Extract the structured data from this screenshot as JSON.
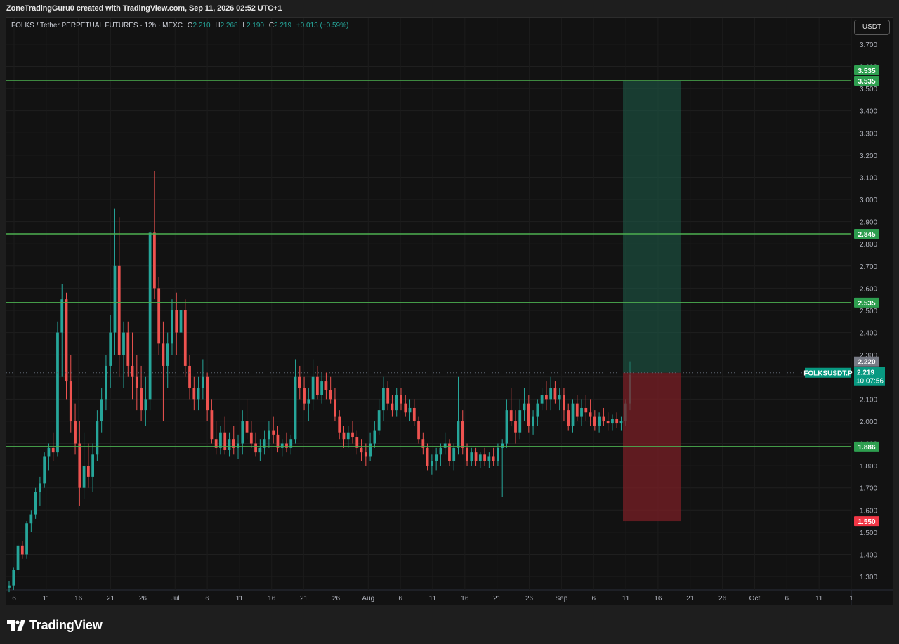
{
  "header": {
    "creator": "ZoneTradingGuru0 created with TradingView.com, Sep 11, 2026 02:52 UTC+1"
  },
  "legend": {
    "symbol": "FOLKS / Tether PERPETUAL FUTURES · 12h · MEXC",
    "o_label": "O",
    "o": "2.210",
    "h_label": "H",
    "h": "2.268",
    "l_label": "L",
    "l": "2.190",
    "c_label": "C",
    "c": "2.219",
    "change": "+0.013 (+0.59%)"
  },
  "currency_button": "USDT",
  "footer": {
    "brand": "TradingView"
  },
  "colors": {
    "up": "#26a69a",
    "down": "#ef5350",
    "level_line": "#4caf50",
    "target_zone": "#1e5f4b",
    "stop_zone": "#7a1f26",
    "price_tag": "#089981",
    "stop_tag": "#f23645",
    "background": "#121212"
  },
  "chart_data": {
    "type": "candlestick",
    "title": "FOLKS / Tether PERPETUAL FUTURES · 12h · MEXC",
    "timeframe": "12h",
    "y_range": [
      1.24,
      3.82
    ],
    "y_ticks": [
      "3.700",
      "3.600",
      "3.500",
      "3.400",
      "3.300",
      "3.200",
      "3.100",
      "3.000",
      "2.900",
      "2.800",
      "2.700",
      "2.600",
      "2.500",
      "2.400",
      "2.300",
      "2.200",
      "2.100",
      "2.000",
      "1.900",
      "1.800",
      "1.700",
      "1.600",
      "1.500",
      "1.400",
      "1.300"
    ],
    "x_ticks": [
      "6",
      "11",
      "16",
      "21",
      "26",
      "Jul",
      "6",
      "11",
      "16",
      "21",
      "26",
      "Aug",
      "6",
      "11",
      "16",
      "21",
      "26",
      "Sep",
      "6",
      "11",
      "16",
      "21",
      "26",
      "Oct",
      "6",
      "11",
      "1"
    ],
    "horizontal_levels": [
      {
        "price": 3.535,
        "label": "3.535"
      },
      {
        "price": 2.845,
        "label": "2.845"
      },
      {
        "price": 2.535,
        "label": "2.535"
      },
      {
        "price": 1.886,
        "label": "1.886"
      }
    ],
    "position": {
      "type": "long",
      "entry": 2.219,
      "target": 3.535,
      "stop": 1.55,
      "target_label": "3.535",
      "stop_label": "1.550"
    },
    "last_price": {
      "symbol": "FOLKSUSDT.P",
      "price": "2.219",
      "countdown": "10:07:56",
      "high_marker": "2.220"
    },
    "candles": [
      [
        1.25,
        1.28,
        1.23,
        1.26
      ],
      [
        1.26,
        1.34,
        1.24,
        1.33
      ],
      [
        1.33,
        1.45,
        1.31,
        1.44
      ],
      [
        1.44,
        1.46,
        1.38,
        1.4
      ],
      [
        1.4,
        1.55,
        1.38,
        1.54
      ],
      [
        1.54,
        1.6,
        1.5,
        1.58
      ],
      [
        1.58,
        1.7,
        1.56,
        1.68
      ],
      [
        1.68,
        1.75,
        1.62,
        1.72
      ],
      [
        1.72,
        1.86,
        1.7,
        1.84
      ],
      [
        1.84,
        1.9,
        1.78,
        1.88
      ],
      [
        1.88,
        1.95,
        1.82,
        1.86
      ],
      [
        1.86,
        2.45,
        1.84,
        2.4
      ],
      [
        2.4,
        2.62,
        2.2,
        2.55
      ],
      [
        2.55,
        2.58,
        2.1,
        2.18
      ],
      [
        2.18,
        2.3,
        1.95,
        2.0
      ],
      [
        2.0,
        2.08,
        1.85,
        1.9
      ],
      [
        1.9,
        2.0,
        1.62,
        1.7
      ],
      [
        1.7,
        1.95,
        1.65,
        1.8
      ],
      [
        1.8,
        1.9,
        1.7,
        1.75
      ],
      [
        1.75,
        1.9,
        1.68,
        1.85
      ],
      [
        1.85,
        2.05,
        1.82,
        2.0
      ],
      [
        2.0,
        2.15,
        1.95,
        2.1
      ],
      [
        2.1,
        2.3,
        2.05,
        2.25
      ],
      [
        2.25,
        2.48,
        2.15,
        2.4
      ],
      [
        2.4,
        2.96,
        2.3,
        2.7
      ],
      [
        2.7,
        2.92,
        2.2,
        2.3
      ],
      [
        2.3,
        2.45,
        2.15,
        2.4
      ],
      [
        2.4,
        2.45,
        2.2,
        2.25
      ],
      [
        2.25,
        2.4,
        2.1,
        2.2
      ],
      [
        2.2,
        2.3,
        2.05,
        2.15
      ],
      [
        2.15,
        2.25,
        2.0,
        2.05
      ],
      [
        2.05,
        2.2,
        1.98,
        2.1
      ],
      [
        2.1,
        2.86,
        2.05,
        2.85
      ],
      [
        2.85,
        3.13,
        2.55,
        2.6
      ],
      [
        2.6,
        2.65,
        2.3,
        2.35
      ],
      [
        2.35,
        2.45,
        2.0,
        2.25
      ],
      [
        2.25,
        2.4,
        2.15,
        2.35
      ],
      [
        2.35,
        2.55,
        2.3,
        2.5
      ],
      [
        2.5,
        2.58,
        2.3,
        2.4
      ],
      [
        2.4,
        2.6,
        2.35,
        2.5
      ],
      [
        2.5,
        2.55,
        2.2,
        2.25
      ],
      [
        2.25,
        2.3,
        2.1,
        2.15
      ],
      [
        2.15,
        2.2,
        2.05,
        2.1
      ],
      [
        2.1,
        2.2,
        2.05,
        2.15
      ],
      [
        2.15,
        2.28,
        2.1,
        2.2
      ],
      [
        2.2,
        2.22,
        2.0,
        2.05
      ],
      [
        2.05,
        2.1,
        1.9,
        1.92
      ],
      [
        1.92,
        2.0,
        1.85,
        1.88
      ],
      [
        1.88,
        1.98,
        1.85,
        1.95
      ],
      [
        1.95,
        2.02,
        1.85,
        1.87
      ],
      [
        1.87,
        1.95,
        1.84,
        1.92
      ],
      [
        1.92,
        1.98,
        1.85,
        1.88
      ],
      [
        1.88,
        1.94,
        1.83,
        1.9
      ],
      [
        1.9,
        2.05,
        1.85,
        2.0
      ],
      [
        2.0,
        2.1,
        1.92,
        1.95
      ],
      [
        1.95,
        2.0,
        1.88,
        1.9
      ],
      [
        1.9,
        1.95,
        1.84,
        1.86
      ],
      [
        1.86,
        1.92,
        1.82,
        1.88
      ],
      [
        1.88,
        1.96,
        1.85,
        1.92
      ],
      [
        1.92,
        2.0,
        1.88,
        1.96
      ],
      [
        1.96,
        2.02,
        1.9,
        1.94
      ],
      [
        1.94,
        1.98,
        1.86,
        1.88
      ],
      [
        1.88,
        1.92,
        1.84,
        1.9
      ],
      [
        1.9,
        1.95,
        1.86,
        1.88
      ],
      [
        1.88,
        1.94,
        1.85,
        1.92
      ],
      [
        1.92,
        2.28,
        1.9,
        2.2
      ],
      [
        2.2,
        2.25,
        2.1,
        2.15
      ],
      [
        2.15,
        2.2,
        2.05,
        2.08
      ],
      [
        2.08,
        2.15,
        2.0,
        2.1
      ],
      [
        2.1,
        2.28,
        2.05,
        2.2
      ],
      [
        2.2,
        2.25,
        2.1,
        2.12
      ],
      [
        2.12,
        2.22,
        2.08,
        2.18
      ],
      [
        2.18,
        2.22,
        2.1,
        2.14
      ],
      [
        2.14,
        2.2,
        2.08,
        2.1
      ],
      [
        2.1,
        2.15,
        2.0,
        2.02
      ],
      [
        2.02,
        2.05,
        1.92,
        1.95
      ],
      [
        1.95,
        1.98,
        1.88,
        1.92
      ],
      [
        1.92,
        1.98,
        1.88,
        1.95
      ],
      [
        1.95,
        2.0,
        1.9,
        1.93
      ],
      [
        1.93,
        1.96,
        1.85,
        1.88
      ],
      [
        1.88,
        1.92,
        1.82,
        1.86
      ],
      [
        1.86,
        1.9,
        1.8,
        1.84
      ],
      [
        1.84,
        1.95,
        1.82,
        1.9
      ],
      [
        1.9,
        2.0,
        1.88,
        1.96
      ],
      [
        1.96,
        2.1,
        1.94,
        2.05
      ],
      [
        2.05,
        2.2,
        2.0,
        2.15
      ],
      [
        2.15,
        2.18,
        2.05,
        2.08
      ],
      [
        2.08,
        2.12,
        2.02,
        2.05
      ],
      [
        2.05,
        2.15,
        2.02,
        2.12
      ],
      [
        2.12,
        2.15,
        2.05,
        2.08
      ],
      [
        2.08,
        2.12,
        2.02,
        2.04
      ],
      [
        2.04,
        2.1,
        2.0,
        2.06
      ],
      [
        2.06,
        2.1,
        1.98,
        2.0
      ],
      [
        2.0,
        2.02,
        1.9,
        1.92
      ],
      [
        1.92,
        1.95,
        1.85,
        1.88
      ],
      [
        1.88,
        1.9,
        1.78,
        1.8
      ],
      [
        1.8,
        1.85,
        1.76,
        1.82
      ],
      [
        1.82,
        1.88,
        1.78,
        1.85
      ],
      [
        1.85,
        1.9,
        1.8,
        1.88
      ],
      [
        1.88,
        1.95,
        1.85,
        1.9
      ],
      [
        1.9,
        1.92,
        1.8,
        1.82
      ],
      [
        1.82,
        1.9,
        1.78,
        1.88
      ],
      [
        1.88,
        2.2,
        1.85,
        2.0
      ],
      [
        2.0,
        2.05,
        1.85,
        1.88
      ],
      [
        1.88,
        1.9,
        1.8,
        1.82
      ],
      [
        1.82,
        1.88,
        1.8,
        1.86
      ],
      [
        1.86,
        1.88,
        1.8,
        1.82
      ],
      [
        1.82,
        1.86,
        1.79,
        1.85
      ],
      [
        1.85,
        1.88,
        1.8,
        1.82
      ],
      [
        1.82,
        1.86,
        1.79,
        1.84
      ],
      [
        1.84,
        1.88,
        1.8,
        1.82
      ],
      [
        1.82,
        1.9,
        1.8,
        1.88
      ],
      [
        1.88,
        1.92,
        1.66,
        1.9
      ],
      [
        1.9,
        2.1,
        1.88,
        2.05
      ],
      [
        2.05,
        2.15,
        1.98,
        2.0
      ],
      [
        2.0,
        2.05,
        1.9,
        1.95
      ],
      [
        1.95,
        2.1,
        1.92,
        2.05
      ],
      [
        2.05,
        2.15,
        2.0,
        2.08
      ],
      [
        2.08,
        2.12,
        1.95,
        1.98
      ],
      [
        1.98,
        2.05,
        1.94,
        2.02
      ],
      [
        2.02,
        2.1,
        1.98,
        2.08
      ],
      [
        2.08,
        2.15,
        2.05,
        2.12
      ],
      [
        2.12,
        2.18,
        2.05,
        2.1
      ],
      [
        2.1,
        2.2,
        2.05,
        2.15
      ],
      [
        2.15,
        2.18,
        2.08,
        2.1
      ],
      [
        2.1,
        2.15,
        2.05,
        2.12
      ],
      [
        2.12,
        2.15,
        2.0,
        2.05
      ],
      [
        2.05,
        2.08,
        1.96,
        1.98
      ],
      [
        1.98,
        2.1,
        1.95,
        2.08
      ],
      [
        2.08,
        2.12,
        2.0,
        2.02
      ],
      [
        2.02,
        2.1,
        1.98,
        2.06
      ],
      [
        2.06,
        2.12,
        2.0,
        2.04
      ],
      [
        2.04,
        2.1,
        1.98,
        2.02
      ],
      [
        2.02,
        2.05,
        1.96,
        1.98
      ],
      [
        1.98,
        2.04,
        1.95,
        2.02
      ],
      [
        2.02,
        2.06,
        1.98,
        2.0
      ],
      [
        2.0,
        2.04,
        1.96,
        1.99
      ],
      [
        1.99,
        2.03,
        1.96,
        2.01
      ],
      [
        2.01,
        2.04,
        1.97,
        1.99
      ],
      [
        1.99,
        2.02,
        1.96,
        2.0
      ],
      [
        2.0,
        2.1,
        1.98,
        2.08
      ],
      [
        2.08,
        2.27,
        2.05,
        2.21
      ]
    ]
  }
}
